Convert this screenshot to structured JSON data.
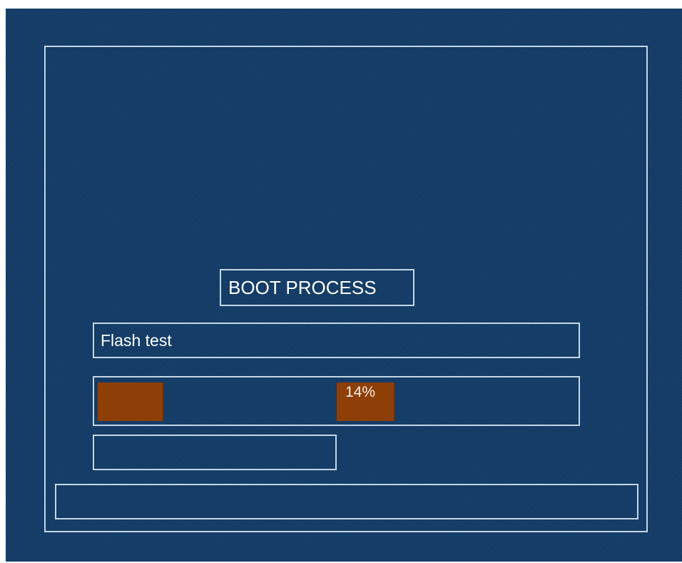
{
  "boot_screen": {
    "title": "BOOT PROCESS",
    "status": "Flash test",
    "progress": {
      "percent": 14,
      "label": "14%"
    },
    "colors": {
      "background": "#133c68",
      "outline": "#c6d6e6",
      "progress_fill": "#8e3e07",
      "text": "#ffffff"
    }
  }
}
